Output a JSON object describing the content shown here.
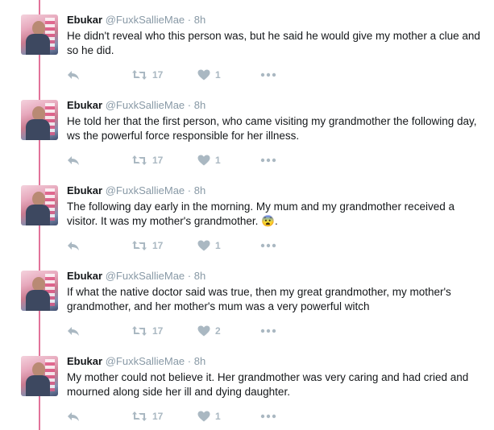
{
  "thread": {
    "tweets": [
      {
        "name": "Ebukar",
        "handle": "@FuxkSallieMae",
        "sep": "·",
        "time": "8h",
        "text": "He didn't reveal who this person was,  but he said he would give my mother a clue and so he did.",
        "retweets": "17",
        "likes": "1"
      },
      {
        "name": "Ebukar",
        "handle": "@FuxkSallieMae",
        "sep": "·",
        "time": "8h",
        "text": "He told her that the first person,  who came visiting my grandmother the following day, ws the powerful force responsible for her illness.",
        "retweets": "17",
        "likes": "1"
      },
      {
        "name": "Ebukar",
        "handle": "@FuxkSallieMae",
        "sep": "·",
        "time": "8h",
        "text": "The following day early in the morning.  My mum and my grandmother received a visitor.  It was my mother's grandmother.  😨.",
        "retweets": "17",
        "likes": "1"
      },
      {
        "name": "Ebukar",
        "handle": "@FuxkSallieMae",
        "sep": "·",
        "time": "8h",
        "text": "If what the native doctor said was true, then my great grandmother, my mother's grandmother, and her mother's mum was a very powerful witch",
        "retweets": "17",
        "likes": "2"
      },
      {
        "name": "Ebukar",
        "handle": "@FuxkSallieMae",
        "sep": "·",
        "time": "8h",
        "text": "My mother could not believe it.  Her grandmother was very caring and had cried and mourned along side her ill and dying daughter.",
        "retweets": "17",
        "likes": "1"
      }
    ]
  },
  "icons": {
    "reply": "reply-icon",
    "retweet": "retweet-icon",
    "like": "heart-icon",
    "more": "more-dots-icon"
  },
  "colors": {
    "thread_line": "#e2739a",
    "meta_gray": "#8899a6",
    "action_gray": "#aab8c2",
    "text": "#14171a"
  }
}
